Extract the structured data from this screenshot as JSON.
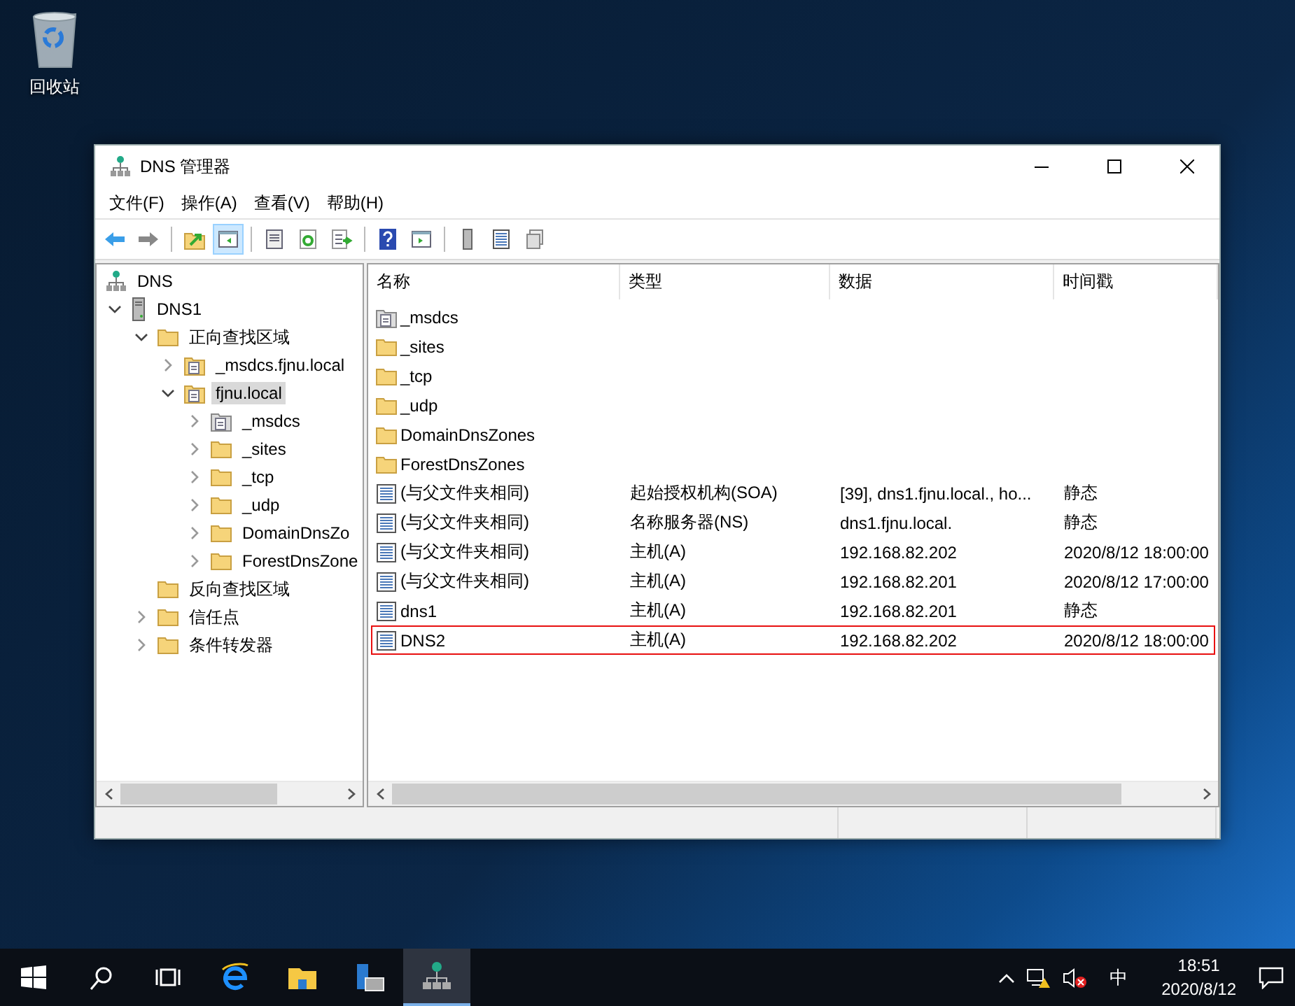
{
  "desktop_icons": [
    {
      "label": "回收站",
      "kind": "recycle-bin"
    }
  ],
  "window": {
    "title": "DNS 管理器"
  },
  "menu": [
    "文件(F)",
    "操作(A)",
    "查看(V)",
    "帮助(H)"
  ],
  "toolbar": [
    [
      {
        "kind": "back",
        "selected": false
      },
      {
        "kind": "forward",
        "selected": false
      }
    ],
    [
      {
        "kind": "up",
        "selected": false
      },
      {
        "kind": "tree",
        "selected": true
      }
    ],
    [
      {
        "kind": "properties",
        "selected": false
      },
      {
        "kind": "refresh",
        "selected": false
      },
      {
        "kind": "export",
        "selected": false
      }
    ],
    [
      {
        "kind": "help",
        "selected": false
      },
      {
        "kind": "action",
        "selected": false
      }
    ],
    [
      {
        "kind": "server",
        "selected": false
      },
      {
        "kind": "list",
        "selected": false
      },
      {
        "kind": "copy",
        "selected": false
      }
    ]
  ],
  "tree": [
    {
      "label": "DNS",
      "kind": "root",
      "selected": false,
      "children": [
        {
          "label": "DNS1",
          "kind": "server",
          "expanded": true,
          "selected": false,
          "children": [
            {
              "label": "正向查找区域",
              "kind": "folder",
              "expanded": true,
              "selected": false,
              "children": [
                {
                  "label": "_msdcs.fjnu.local",
                  "kind": "zone",
                  "expanded": false,
                  "selected": false
                },
                {
                  "label": "fjnu.local",
                  "kind": "zone",
                  "expanded": true,
                  "selected": true,
                  "children": [
                    {
                      "label": "_msdcs",
                      "kind": "delegation",
                      "expanded": false,
                      "selected": false
                    },
                    {
                      "label": "_sites",
                      "kind": "folder",
                      "expanded": false,
                      "selected": false
                    },
                    {
                      "label": "_tcp",
                      "kind": "folder",
                      "expanded": false,
                      "selected": false
                    },
                    {
                      "label": "_udp",
                      "kind": "folder",
                      "expanded": false,
                      "selected": false
                    },
                    {
                      "label": "DomainDnsZo",
                      "kind": "folder",
                      "expanded": false,
                      "selected": false
                    },
                    {
                      "label": "ForestDnsZone",
                      "kind": "folder",
                      "expanded": false,
                      "selected": false
                    }
                  ]
                }
              ]
            },
            {
              "label": "反向查找区域",
              "kind": "folder",
              "selected": false
            },
            {
              "label": "信任点",
              "kind": "folder",
              "expanded": false,
              "selected": false
            },
            {
              "label": "条件转发器",
              "kind": "folder",
              "expanded": false,
              "selected": false
            }
          ]
        }
      ]
    }
  ],
  "table": {
    "columns": [
      "名称",
      "类型",
      "数据",
      "时间戳"
    ],
    "rows": [
      {
        "kind": "delegation",
        "cells": [
          "_msdcs"
        ],
        "outlined": false
      },
      {
        "kind": "folder",
        "cells": [
          "_sites"
        ],
        "outlined": false
      },
      {
        "kind": "folder",
        "cells": [
          "_tcp"
        ],
        "outlined": false
      },
      {
        "kind": "folder",
        "cells": [
          "_udp"
        ],
        "outlined": false
      },
      {
        "kind": "folder",
        "cells": [
          "DomainDnsZones"
        ],
        "outlined": false
      },
      {
        "kind": "folder",
        "cells": [
          "ForestDnsZones"
        ],
        "outlined": false
      },
      {
        "kind": "record",
        "cells": [
          "(与父文件夹相同)",
          "起始授权机构(SOA)",
          "[39], dns1.fjnu.local., ho...",
          "静态"
        ],
        "outlined": false
      },
      {
        "kind": "record",
        "cells": [
          "(与父文件夹相同)",
          "名称服务器(NS)",
          "dns1.fjnu.local.",
          "静态"
        ],
        "outlined": false
      },
      {
        "kind": "record",
        "cells": [
          "(与父文件夹相同)",
          "主机(A)",
          "192.168.82.202",
          "2020/8/12 18:00:00"
        ],
        "outlined": false
      },
      {
        "kind": "record",
        "cells": [
          "(与父文件夹相同)",
          "主机(A)",
          "192.168.82.201",
          "2020/8/12 17:00:00"
        ],
        "outlined": false
      },
      {
        "kind": "record",
        "cells": [
          "dns1",
          "主机(A)",
          "192.168.82.201",
          "静态"
        ],
        "outlined": false
      },
      {
        "kind": "record",
        "cells": [
          "DNS2",
          "主机(A)",
          "192.168.82.202",
          "2020/8/12 18:00:00"
        ],
        "outlined": true
      }
    ]
  },
  "taskbar": [
    {
      "kind": "start",
      "selected": false
    },
    {
      "kind": "search",
      "selected": false
    },
    {
      "kind": "task-view",
      "selected": false
    },
    {
      "kind": "browser",
      "selected": false
    },
    {
      "kind": "explorer",
      "selected": false
    },
    {
      "kind": "server-manager",
      "selected": false
    },
    {
      "kind": "dns",
      "selected": true
    }
  ],
  "tray": {
    "ime": "中",
    "time": "18:51",
    "date": "2020/8/12"
  }
}
